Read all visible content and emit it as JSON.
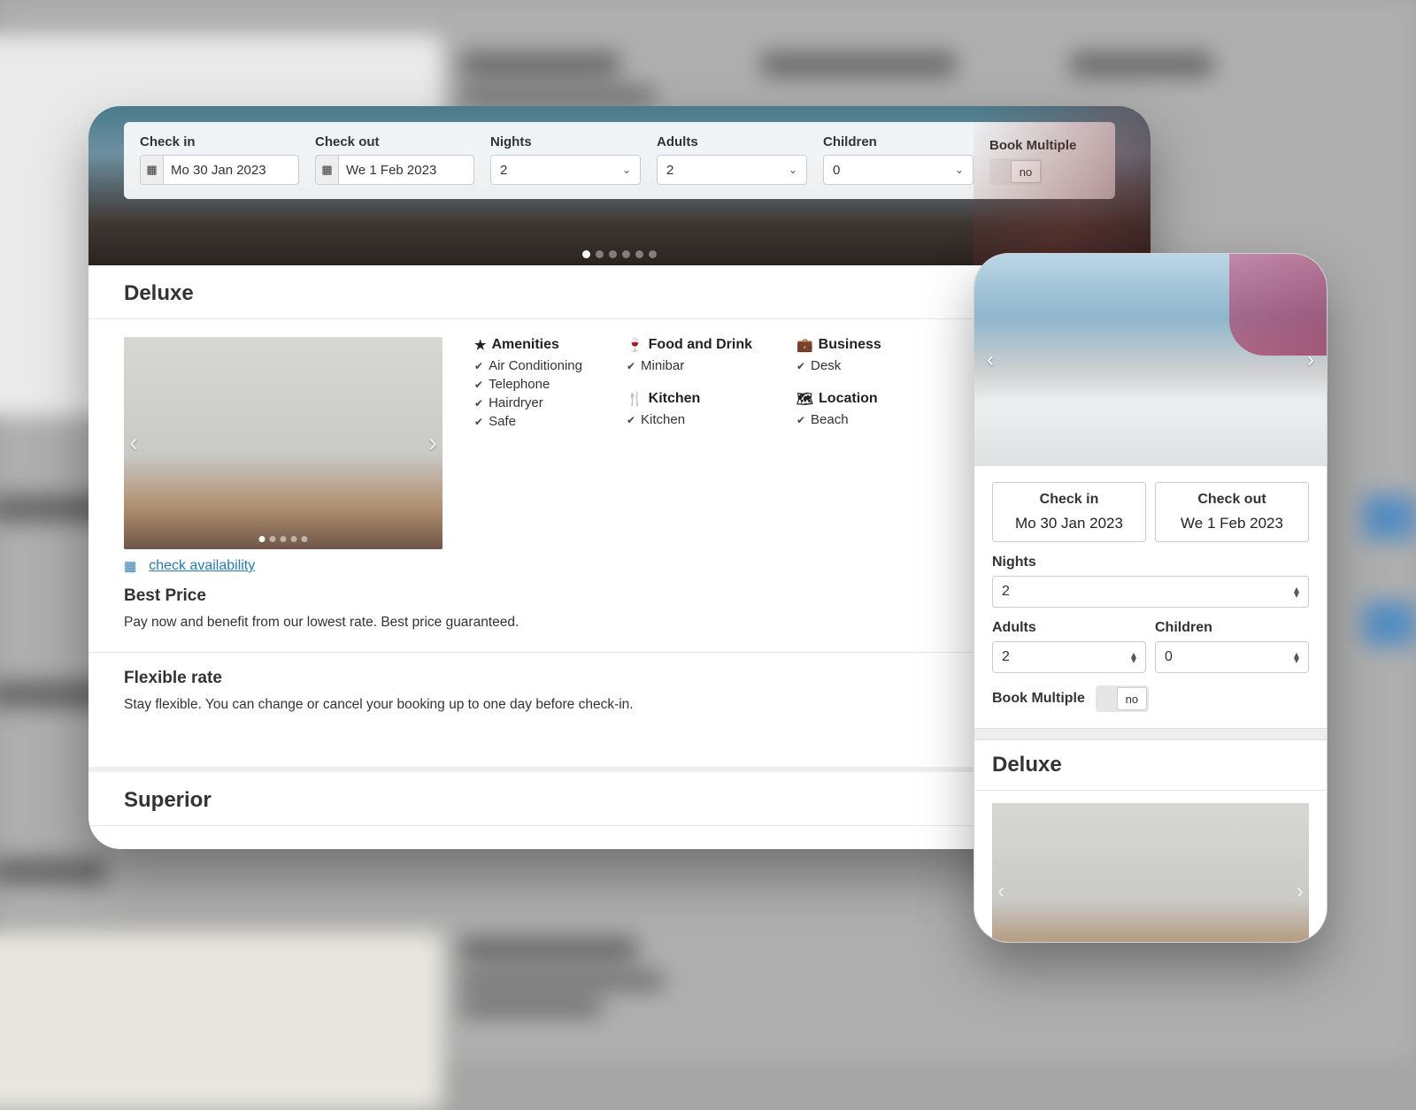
{
  "search": {
    "checkin_label": "Check in",
    "checkout_label": "Check out",
    "nights_label": "Nights",
    "adults_label": "Adults",
    "children_label": "Children",
    "multiple_label": "Book Multiple",
    "checkin_value": "Mo 30 Jan 2023",
    "checkout_value": "We 1 Feb 2023",
    "nights_value": "2",
    "adults_value": "2",
    "children_value": "0",
    "multiple_value": "no"
  },
  "room": {
    "deluxe": {
      "title": "Deluxe",
      "amenities_heading": "Amenities",
      "food_heading": "Food and Drink",
      "business_heading": "Business",
      "kitchen_heading": "Kitchen",
      "location_heading": "Location",
      "amenities": [
        "Air Conditioning",
        "Telephone",
        "Hairdryer",
        "Safe"
      ],
      "food": [
        "Minibar"
      ],
      "kitchen": [
        "Kitchen"
      ],
      "business": [
        "Desk"
      ],
      "location": [
        "Beach"
      ],
      "availability_link": "check availability",
      "rate1_title": "Best Price",
      "rate1_desc": "Pay now and benefit from our lowest rate. Best price guaranteed.",
      "rate2_title": "Flexible rate",
      "rate2_desc": "Stay flexible. You can change or cancel your booking up to one day before check-in."
    },
    "superior": {
      "title": "Superior"
    }
  },
  "mobile": {
    "checkin_label": "Check in",
    "checkout_label": "Check out",
    "checkin_value": "Mo 30 Jan 2023",
    "checkout_value": "We 1 Feb 2023",
    "nights_label": "Nights",
    "nights_value": "2",
    "adults_label": "Adults",
    "adults_value": "2",
    "children_label": "Children",
    "children_value": "0",
    "multiple_label": "Book Multiple",
    "multiple_value": "no",
    "room_title": "Deluxe"
  }
}
